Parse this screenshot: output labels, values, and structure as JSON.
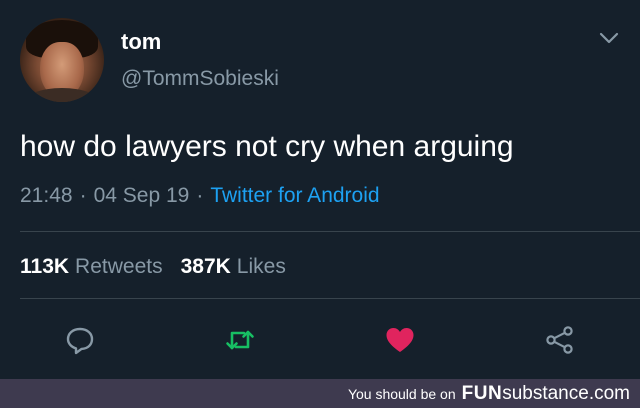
{
  "tweet": {
    "author": {
      "name": "tom",
      "handle": "@TommSobieski"
    },
    "text": "how do lawyers not cry when arguing",
    "time": "21:48",
    "date": "04 Sep 19",
    "separator": "·",
    "source": "Twitter for Android",
    "stats": {
      "retweets_count": "113K",
      "retweets_label": "Retweets",
      "likes_count": "387K",
      "likes_label": "Likes"
    },
    "actions": {
      "reply_icon": "reply-icon",
      "retweet_icon": "retweet-icon",
      "like_icon": "heart-icon",
      "share_icon": "share-icon"
    }
  },
  "watermark": {
    "prefix": "You should be on",
    "brand_bold": "FUN",
    "brand_rest": "substance.com"
  },
  "colors": {
    "background": "#15202b",
    "text_primary": "#ffffff",
    "text_secondary": "#8899a6",
    "link": "#1da1f2",
    "retweet": "#17bf63",
    "like": "#e0245e",
    "divider": "#38444d",
    "footer": "#3e3a4f"
  }
}
